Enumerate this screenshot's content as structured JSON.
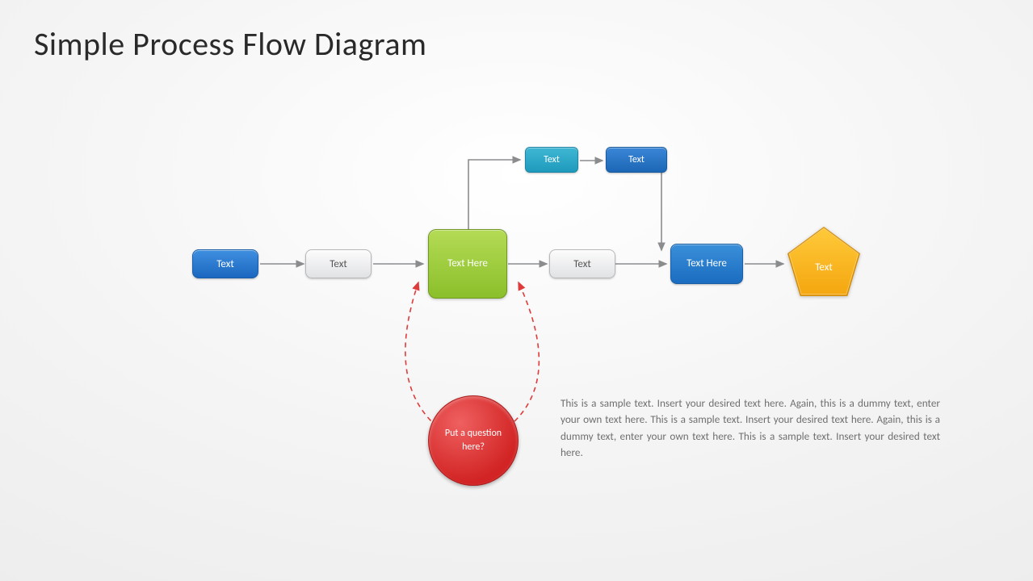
{
  "title": "Simple Process Flow Diagram",
  "nodes": {
    "n1": "Text",
    "n2": "Text",
    "n3": "Text Here",
    "n4": "Text",
    "n5": "Text Here",
    "n6": "Text",
    "top1": "Text",
    "top2": "Text",
    "circle": "Put a question here?"
  },
  "body": "This is a sample text. Insert your desired text here. Again, this is a dummy text, enter your own text here. This is a sample text. Insert your desired text here. Again, this is a dummy text, enter your own text here. This is a sample text. Insert your desired text here.",
  "colors": {
    "arrow": "#8b8c8e",
    "dashed": "#e03b3b",
    "pentagonTop": "#ffca3a",
    "pentagonBot": "#f4a60f",
    "pentagonStroke": "#d48a00"
  }
}
